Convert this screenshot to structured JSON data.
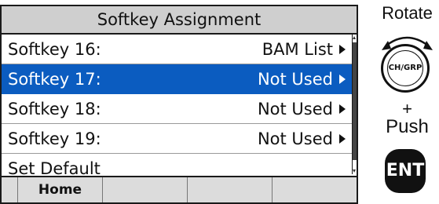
{
  "screen": {
    "title": "Softkey Assignment",
    "items": [
      {
        "label": "Softkey 16:",
        "value": "BAM List"
      },
      {
        "label": "Softkey 17:",
        "value": "Not Used"
      },
      {
        "label": "Softkey 18:",
        "value": "Not Used"
      },
      {
        "label": "Softkey 19:",
        "value": "Not Used"
      },
      {
        "label": "Set Default",
        "value": ""
      }
    ],
    "selected_index": 1,
    "softkeys": [
      "",
      "Home",
      "",
      "",
      ""
    ]
  },
  "controls": {
    "rotate_label": "Rotate",
    "dial_label": "CH/GRP",
    "plus_label": "+",
    "push_label": "Push",
    "enter_label": "ENT"
  },
  "colors": {
    "selection": "#0b5cc0",
    "title_bar": "#cfcfcf"
  }
}
